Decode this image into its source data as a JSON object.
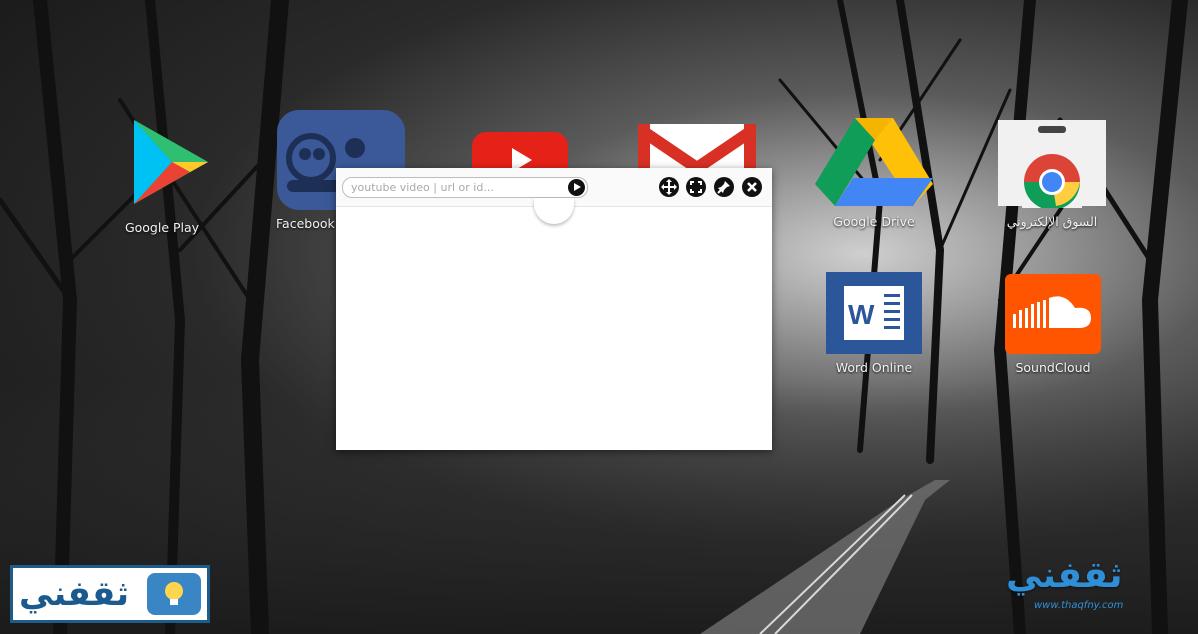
{
  "desktop": {
    "apps": [
      {
        "label": "Google Play",
        "icon": "google-play-icon"
      },
      {
        "label": "Facebook",
        "icon": "facebook-messenger-icon"
      },
      {
        "label": "",
        "icon": "youtube-icon"
      },
      {
        "label": "",
        "icon": "gmail-icon"
      },
      {
        "label": "Google Drive",
        "icon": "google-drive-icon"
      },
      {
        "label": "السوق الإلكتروني",
        "icon": "chrome-web-store-icon"
      },
      {
        "label": "Word Online",
        "icon": "word-online-icon"
      },
      {
        "label": "SoundCloud",
        "icon": "soundcloud-icon"
      }
    ]
  },
  "player": {
    "search_placeholder": "youtube video | url or id...",
    "search_value": "",
    "controls": [
      "move-icon",
      "fullscreen-icon",
      "pin-icon",
      "close-icon"
    ]
  },
  "watermarks": {
    "left_logo_text": "ثقفني",
    "right_logo_text": "ثقفني",
    "right_logo_url": "www.thaqfny.com"
  },
  "colors": {
    "youtube_red": "#e62117",
    "word_blue": "#2b579a",
    "soundcloud_orange": "#ff5500",
    "logo_blue": "#2f8fd6"
  }
}
